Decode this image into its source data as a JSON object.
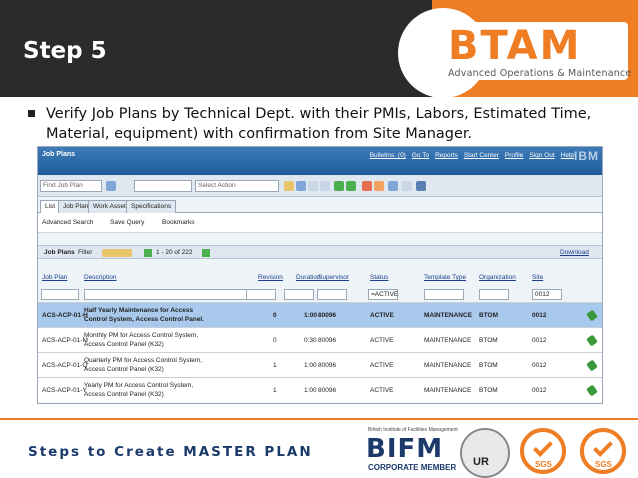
{
  "slide": {
    "title": "Step 5",
    "logo": {
      "mark": "BTAM",
      "subtitle": "Advanced Operations & Maintenance"
    },
    "bullet": "Verify Job Plans by Technical Dept. with their PMIs, Labors, Estimated Time, Material, equipment) with confirmation from Site Manager.",
    "footer": "Steps to Create MASTER PLAN",
    "certs": {
      "bifm_small": "British Institute of Facilities Management",
      "bifm_mark": "BIFM",
      "bifm_sub": "CORPORATE MEMBER",
      "ur": "UR",
      "sgs": "SGS"
    }
  },
  "app": {
    "title": "Job Plans",
    "links": [
      "Bulletins: (0)",
      "Go To",
      "Reports",
      "Start Center",
      "Profile",
      "Sign Out",
      "Help"
    ],
    "vendor": "IBM",
    "toolbar": {
      "find_placeholder": "Find Job Plan",
      "select_action": "Select Action"
    },
    "tabs": [
      "List",
      "Job Plan",
      "Work Assets",
      "Specifications"
    ],
    "search_bar": {
      "advanced": "Advanced Search",
      "save_query": "Save Query",
      "bookmarks": "Bookmarks"
    },
    "table_header": {
      "label": "Job Plans",
      "filter": "Filter",
      "pager": "1 - 20 of 222",
      "download": "Download"
    },
    "columns": [
      "Job Plan",
      "Description",
      "Revision",
      "Duration",
      "Supervisor",
      "Status",
      "Template Type",
      "Organization",
      "Site"
    ],
    "filters": {
      "status": "=ACTIVE",
      "site": "0012"
    },
    "rows": [
      {
        "jobplan": "ACS-ACP-01-H",
        "desc1": "Half Yearly Maintenance for Access",
        "desc2": "Control System, Access Control Panel.",
        "revision": "0",
        "duration": "1:00",
        "supervisor": "80096",
        "status": "ACTIVE",
        "template": "MAINTENANCE",
        "org": "BTOM",
        "site": "0012"
      },
      {
        "jobplan": "ACS-ACP-01-M",
        "desc1": "Monthly PM for Access Control System,",
        "desc2": "Access Control Panel (K32)",
        "revision": "0",
        "duration": "0:30",
        "supervisor": "80096",
        "status": "ACTIVE",
        "template": "MAINTENANCE",
        "org": "BTOM",
        "site": "0012"
      },
      {
        "jobplan": "ACS-ACP-01-Q",
        "desc1": "Quarterly PM for Access Control System,",
        "desc2": "Access Control Panel (K32)",
        "revision": "1",
        "duration": "1:00",
        "supervisor": "80096",
        "status": "ACTIVE",
        "template": "MAINTENANCE",
        "org": "BTOM",
        "site": "0012"
      },
      {
        "jobplan": "ACS-ACP-01-Y",
        "desc1": "Yearly PM for Access Control System,",
        "desc2": "Access Control Panel (K32)",
        "revision": "1",
        "duration": "1:00",
        "supervisor": "80096",
        "status": "ACTIVE",
        "template": "MAINTENANCE",
        "org": "BTOM",
        "site": "0012"
      }
    ]
  }
}
